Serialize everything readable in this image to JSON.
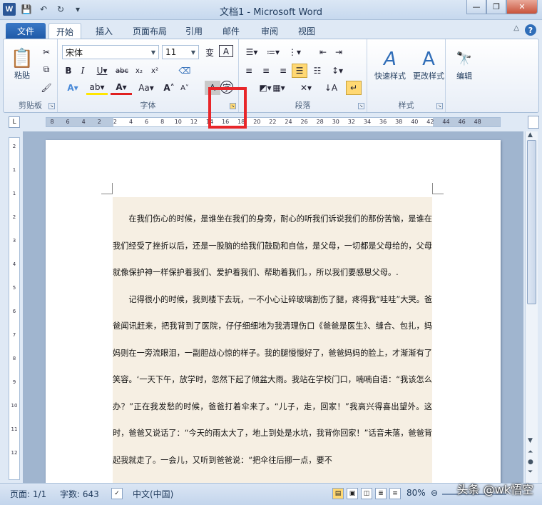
{
  "window": {
    "title": "文档1 - Microsoft Word",
    "logo": "W"
  },
  "tabs": {
    "file": "文件",
    "home": "开始",
    "insert": "插入",
    "layout": "页面布局",
    "references": "引用",
    "mailings": "邮件",
    "review": "审阅",
    "view": "视图"
  },
  "ribbon": {
    "clipboard": {
      "label": "剪贴板",
      "paste": "粘贴"
    },
    "font": {
      "label": "字体",
      "font_name": "宋体",
      "font_size": "11"
    },
    "paragraph": {
      "label": "段落"
    },
    "styles": {
      "label": "样式",
      "quick": "快速样式",
      "change": "更改样式"
    },
    "editing": {
      "label": "编辑"
    }
  },
  "ruler": {
    "ticks": [
      "8",
      "6",
      "4",
      "2",
      "2",
      "4",
      "6",
      "8",
      "10",
      "12",
      "14",
      "16",
      "18",
      "20",
      "22",
      "24",
      "26",
      "28",
      "30",
      "32",
      "34",
      "36",
      "38",
      "40",
      "42",
      "44",
      "46",
      "48"
    ]
  },
  "vruler": {
    "ticks": [
      "2",
      "1",
      "1",
      "2",
      "3",
      "4",
      "5",
      "6",
      "7",
      "8",
      "9",
      "10",
      "11",
      "12"
    ]
  },
  "document": {
    "p1": "在我们伤心的时候，是谁坐在我们的身旁，耐心的听我们诉说我们的那份苦恼，是谁在我们经受了挫折以后，还是一股脑的给我们鼓励和自信，是父母，一切都是父母给的，父母就像保护神一样保护着我们、爱护着我们、帮助着我们。，所以我们要感恩父母。.",
    "p2": "记得很小的时候，我到楼下去玩，一不小心让碎玻璃割伤了腿，疼得我“哇哇”大哭。爸爸闻讯赶来，把我背到了医院，仔仔细细地为我清理伤口《爸爸是医生》、缝合、包扎，妈妈则在一旁流眼泪，一副胆战心惊的样子。我的腿慢慢好了，爸爸妈妈的脸上，才渐渐有了笑容。‘一天下午，放学时，忽然下起了倾盆大雨。我站在学校门口，喃喃自语：“我该怎么办？”正在我发愁的时候，爸爸打着伞来了。“儿子，走，回家！”我高兴得喜出望外。这时，爸爸又说话了：“今天的雨太大了，地上到处是水坑，我背你回家！”话音未落，爸爸背起我就走了。一会儿，又听到爸爸说：“把伞往后挪一点，要不"
  },
  "status": {
    "page": "页面: 1/1",
    "words": "字数: 643",
    "lang": "中文(中国)",
    "zoom": "80%"
  },
  "watermark": "头条 @wk悟空"
}
